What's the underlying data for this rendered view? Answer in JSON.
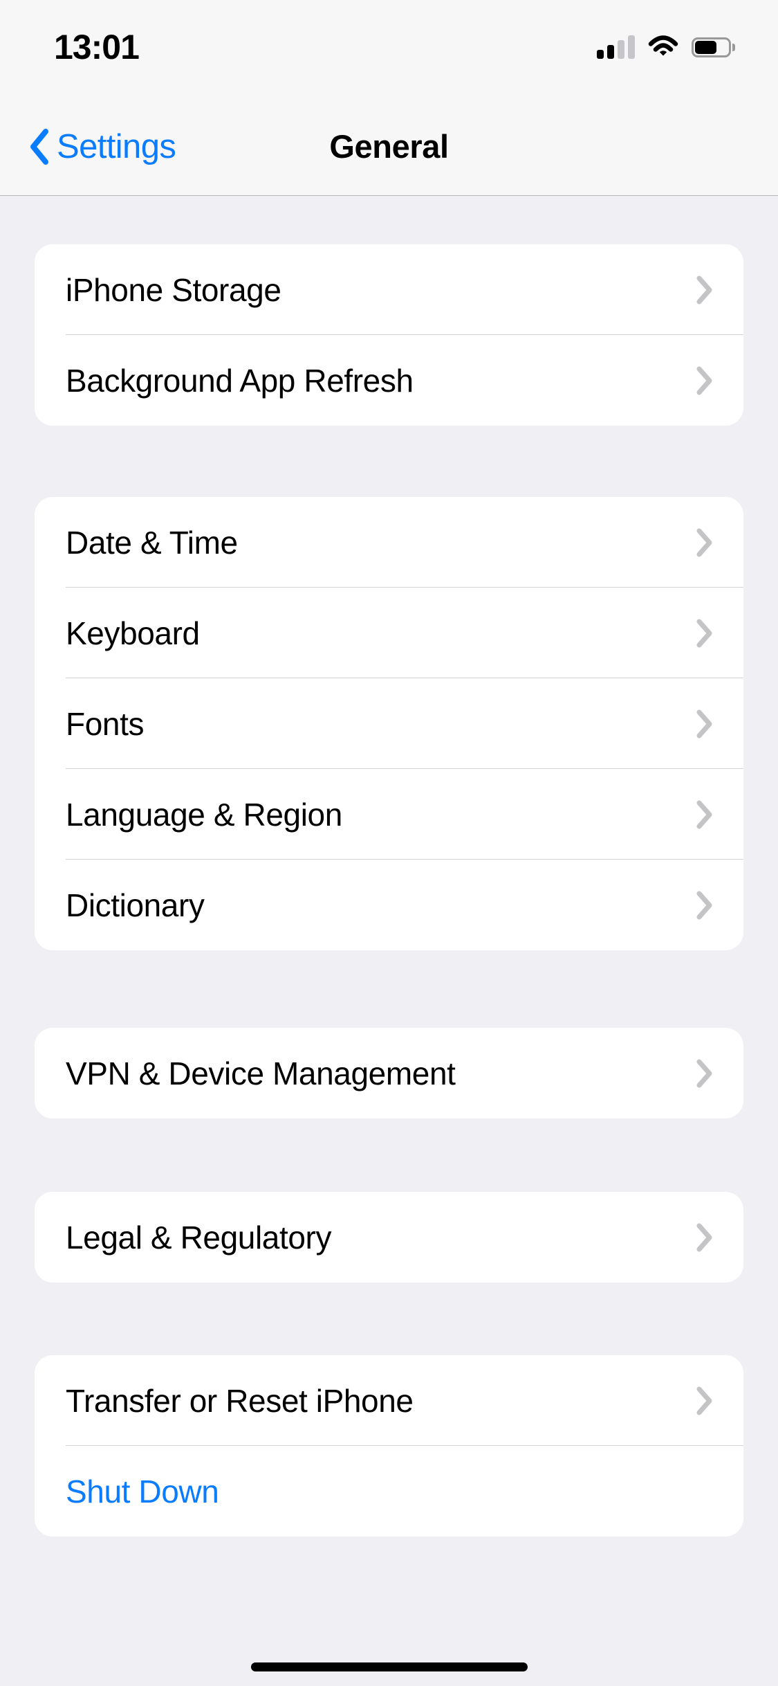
{
  "meta": {
    "platform": "iOS Settings",
    "accent_color": "#0a7cff",
    "page_background": "#f0eff4",
    "card_background": "#ffffff",
    "separator_color": "#d3d3d6",
    "chevron_color": "#c4c4c6",
    "label_color": "#000000"
  },
  "status_bar": {
    "time": "13:01",
    "cellular_icon": "cellular-bars-icon",
    "cellular_bars_filled": 2,
    "cellular_bars_total": 4,
    "wifi_icon": "wifi-icon",
    "battery_icon": "battery-icon",
    "battery_level_percent": 66
  },
  "nav_bar": {
    "back_icon": "chevron-left-icon",
    "back_label": "Settings",
    "title": "General"
  },
  "groups": [
    {
      "id": "storage-group",
      "rows": [
        {
          "label": "iPhone Storage",
          "accessory": "chevron-right-icon",
          "style": "default"
        },
        {
          "label": "Background App Refresh",
          "accessory": "chevron-right-icon",
          "style": "default"
        }
      ]
    },
    {
      "id": "localization-group",
      "rows": [
        {
          "label": "Date & Time",
          "accessory": "chevron-right-icon",
          "style": "default"
        },
        {
          "label": "Keyboard",
          "accessory": "chevron-right-icon",
          "style": "default"
        },
        {
          "label": "Fonts",
          "accessory": "chevron-right-icon",
          "style": "default"
        },
        {
          "label": "Language & Region",
          "accessory": "chevron-right-icon",
          "style": "default"
        },
        {
          "label": "Dictionary",
          "accessory": "chevron-right-icon",
          "style": "default"
        }
      ]
    },
    {
      "id": "vpn-group",
      "rows": [
        {
          "label": "VPN & Device Management",
          "accessory": "chevron-right-icon",
          "style": "default"
        }
      ]
    },
    {
      "id": "legal-group",
      "rows": [
        {
          "label": "Legal & Regulatory",
          "accessory": "chevron-right-icon",
          "style": "default"
        }
      ]
    },
    {
      "id": "reset-group",
      "rows": [
        {
          "label": "Transfer or Reset iPhone",
          "accessory": "chevron-right-icon",
          "style": "default"
        },
        {
          "label": "Shut Down",
          "accessory": "none",
          "style": "action"
        }
      ]
    }
  ],
  "home_indicator": "home-indicator"
}
